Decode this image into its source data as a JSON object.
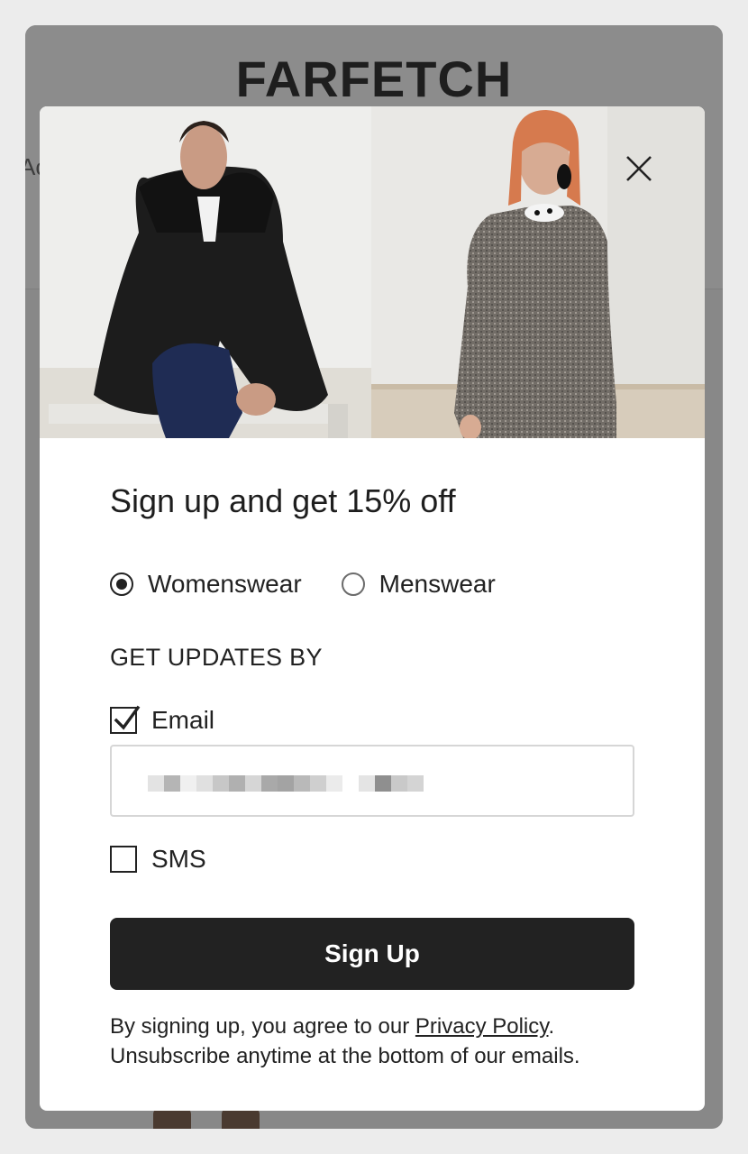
{
  "brand": {
    "logo_text": "FARFETCH",
    "partial_text": "Ac"
  },
  "modal": {
    "close_icon": "close-icon",
    "title": "Sign up and get 15% off",
    "gender_options": [
      {
        "label": "Womenswear",
        "selected": true
      },
      {
        "label": "Menswear",
        "selected": false
      }
    ],
    "updates_heading": "GET UPDATES BY",
    "email_option": {
      "label": "Email",
      "checked": true
    },
    "email_input": {
      "value": "",
      "placeholder": ""
    },
    "sms_option": {
      "label": "SMS",
      "checked": false
    },
    "submit_label": "Sign Up",
    "legal": {
      "prefix": "By signing up, you agree to our ",
      "link_text": "Privacy Policy",
      "suffix": ".",
      "line2": "Unsubscribe anytime at the bottom of our emails."
    }
  },
  "colors": {
    "overlay": "#888888",
    "button_bg": "#222222",
    "button_text": "#ffffff",
    "text": "#222222"
  }
}
